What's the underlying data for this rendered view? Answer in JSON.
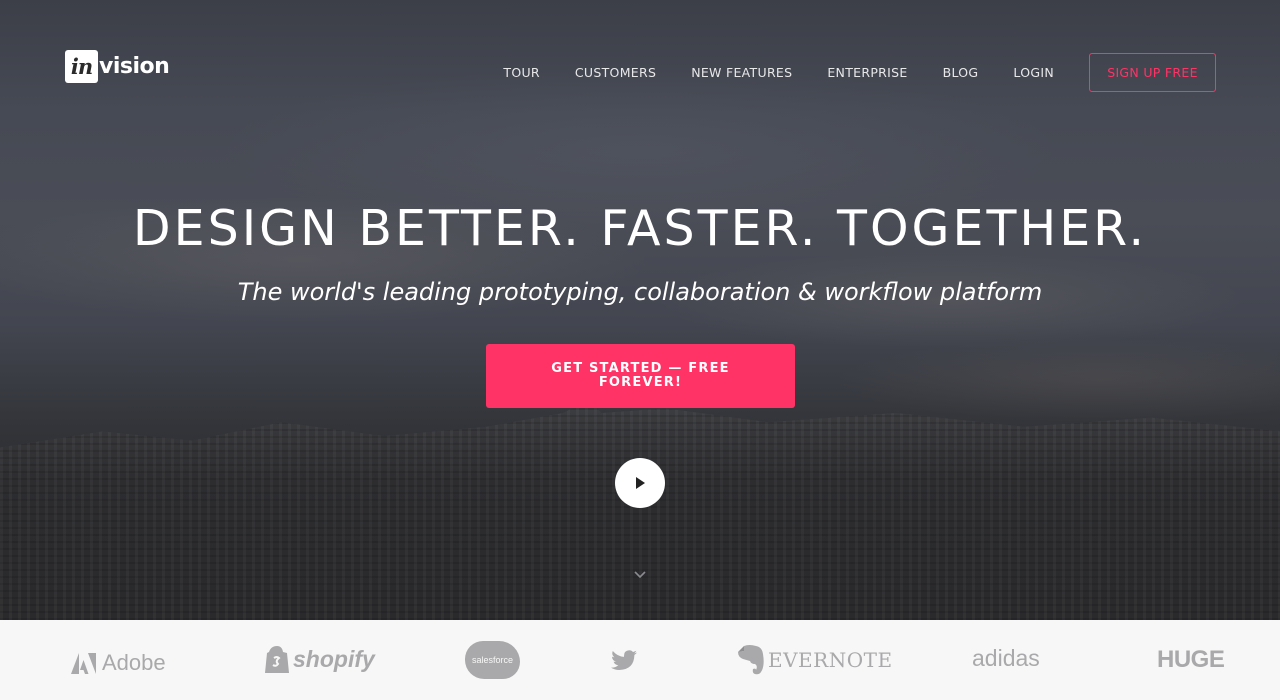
{
  "brand": {
    "logo_mark": "in",
    "logo_rest": "vision"
  },
  "nav": {
    "items": [
      {
        "label": "TOUR"
      },
      {
        "label": "CUSTOMERS"
      },
      {
        "label": "NEW FEATURES"
      },
      {
        "label": "ENTERPRISE"
      },
      {
        "label": "BLOG"
      },
      {
        "label": "LOGIN"
      }
    ],
    "signup_label": "SIGN UP FREE"
  },
  "hero": {
    "headline": "DESIGN BETTER. FASTER. TOGETHER.",
    "subhead": "The world's leading prototyping, collaboration & workflow platform",
    "cta_label": "GET STARTED — FREE FOREVER!",
    "play_icon": "play-icon",
    "scroll_icon": "chevron-down-icon"
  },
  "customer_logos": {
    "adobe": "Adobe",
    "shopify": "shopify",
    "salesforce": "salesforce",
    "twitter_icon": "twitter-bird-icon",
    "evernote": "EVERNOTE",
    "adidas": "adidas",
    "huge": "HUGE"
  },
  "colors": {
    "accent": "#ff3366",
    "logo_gray": "#a9a9ab",
    "strip_bg": "#f7f7f7"
  }
}
